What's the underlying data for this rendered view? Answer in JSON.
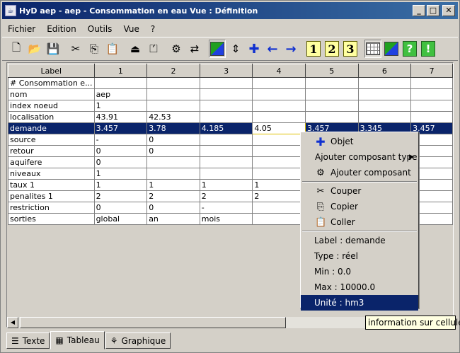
{
  "window": {
    "title": "HyD aep - aep - Consommation en eau Vue  : Définition",
    "minimize": "_",
    "maximize": "□",
    "close": "✕"
  },
  "menu": [
    "Fichier",
    "Edition",
    "Outils",
    "Vue",
    "?"
  ],
  "toolbar": {
    "icons": [
      "new-file-icon",
      "open-folder-icon",
      "save-disk-icon",
      "cut-icon",
      "copy-icon",
      "paste-icon",
      "add-row-icon",
      "remove-row-icon",
      "add-component-icon",
      "network-icon",
      "select-all-icon",
      "expand-icon",
      "add-icon",
      "arrow-left-icon",
      "arrow-right-icon",
      "number-1-icon",
      "number-2-icon",
      "number-3-icon",
      "table-view-icon",
      "color-view-icon",
      "help-icon",
      "info-icon"
    ],
    "num1": "1",
    "num2": "2",
    "num3": "3",
    "help": "?",
    "info": "!"
  },
  "table": {
    "headers": [
      "Label",
      "1",
      "2",
      "3",
      "4",
      "5",
      "6",
      "7"
    ],
    "rows": [
      [
        "# Consommation e...",
        "",
        "",
        "",
        "",
        "",
        "",
        ""
      ],
      [
        "nom",
        "aep",
        "",
        "",
        "",
        "",
        "",
        ""
      ],
      [
        "index noeud",
        "1",
        "",
        "",
        "",
        "",
        "",
        ""
      ],
      [
        "localisation",
        "43.91",
        "42.53",
        "",
        "",
        "",
        "",
        ""
      ],
      [
        "demande",
        "3.457",
        "3.78",
        "4.185",
        "4.05",
        "3.457",
        "3.345",
        "3.457"
      ],
      [
        "source",
        "-",
        "0",
        "",
        "",
        "",
        "",
        ""
      ],
      [
        "retour",
        "0",
        "0",
        "",
        "",
        "",
        "",
        ""
      ],
      [
        "aquifere",
        "0",
        "",
        "",
        "",
        "",
        "",
        ""
      ],
      [
        "niveaux",
        "1",
        "",
        "",
        "",
        "",
        "",
        ""
      ],
      [
        "taux 1",
        "1",
        "1",
        "1",
        "1",
        "",
        "",
        ""
      ],
      [
        "penalites 1",
        "2",
        "2",
        "2",
        "2",
        "",
        "",
        ""
      ],
      [
        "restriction",
        "0",
        "0",
        "-",
        "",
        "",
        "",
        ""
      ],
      [
        "sorties",
        "global",
        "an",
        "mois",
        "",
        "",
        "",
        ""
      ]
    ],
    "selected_row": 4,
    "focused_col": 4
  },
  "context_menu": {
    "objet": "Objet",
    "ajouter_type": "Ajouter composant type",
    "ajouter": "Ajouter composant",
    "couper": "Couper",
    "copier": "Copier",
    "coller": "Coller",
    "label": "Label : demande",
    "type": "Type : réel",
    "min": "Min : 0.0",
    "max": "Max : 10000.0",
    "unite": "Unité : hm3"
  },
  "tooltip": "information sur cellule",
  "tabs": {
    "texte": "Texte",
    "tableau": "Tableau",
    "graphique": "Graphique",
    "active": "Tableau"
  }
}
